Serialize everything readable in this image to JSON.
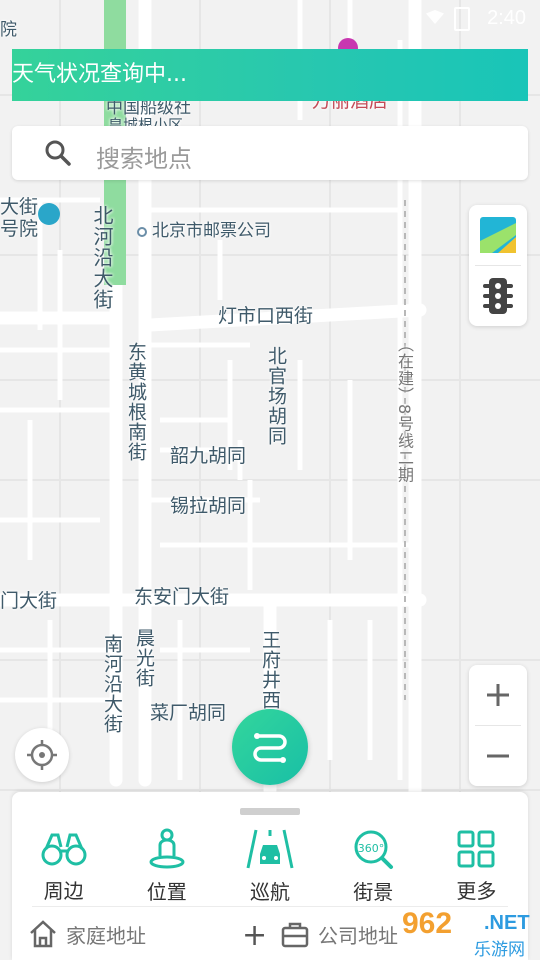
{
  "status_bar": {
    "time": "2:40"
  },
  "weather_banner": {
    "text": "天气状况查询中..."
  },
  "search": {
    "placeholder": "搜索地点"
  },
  "map_labels": {
    "beihe_yan": "北河沿大街",
    "post_company": "北京市邮票公司",
    "dengshikou": "灯市口西街",
    "donghuang": "东黄城根南街",
    "beiguanchang": "北官场胡同",
    "shaojiu": "韶九胡同",
    "xila": "锡拉胡同",
    "dongan_men": "东安门大街",
    "dongan_men_left": "门大街",
    "nanheyan": "南河沿大街",
    "chenguang": "晨光街",
    "caichang": "菜厂胡同",
    "wangfujing": "王府井西",
    "line8": "（在建）8号线二期",
    "wanli_hotel": "万丽酒店",
    "shipbuilding": "中国船级社",
    "huangcheng": "皇城根小区",
    "dajie_left": "大街",
    "hospital_left": "号院",
    "yuan_top": "院"
  },
  "toolbar": {
    "items": [
      {
        "label": "周边",
        "icon": "binoculars-icon"
      },
      {
        "label": "位置",
        "icon": "person-location-icon"
      },
      {
        "label": "巡航",
        "icon": "car-road-icon"
      },
      {
        "label": "街景",
        "icon": "street-view-360-icon"
      },
      {
        "label": "更多",
        "icon": "grid-more-icon"
      }
    ]
  },
  "addresses": {
    "home": "家庭地址",
    "company": "公司地址"
  },
  "watermark": {
    "number": "962",
    "net": ".NET",
    "cn": "乐游网"
  },
  "colors": {
    "accent": "#27c7b0",
    "accent_start": "#35d29a",
    "map_bg": "#f2f2f2",
    "road": "#ffffff",
    "label": "#3f5a6a"
  }
}
